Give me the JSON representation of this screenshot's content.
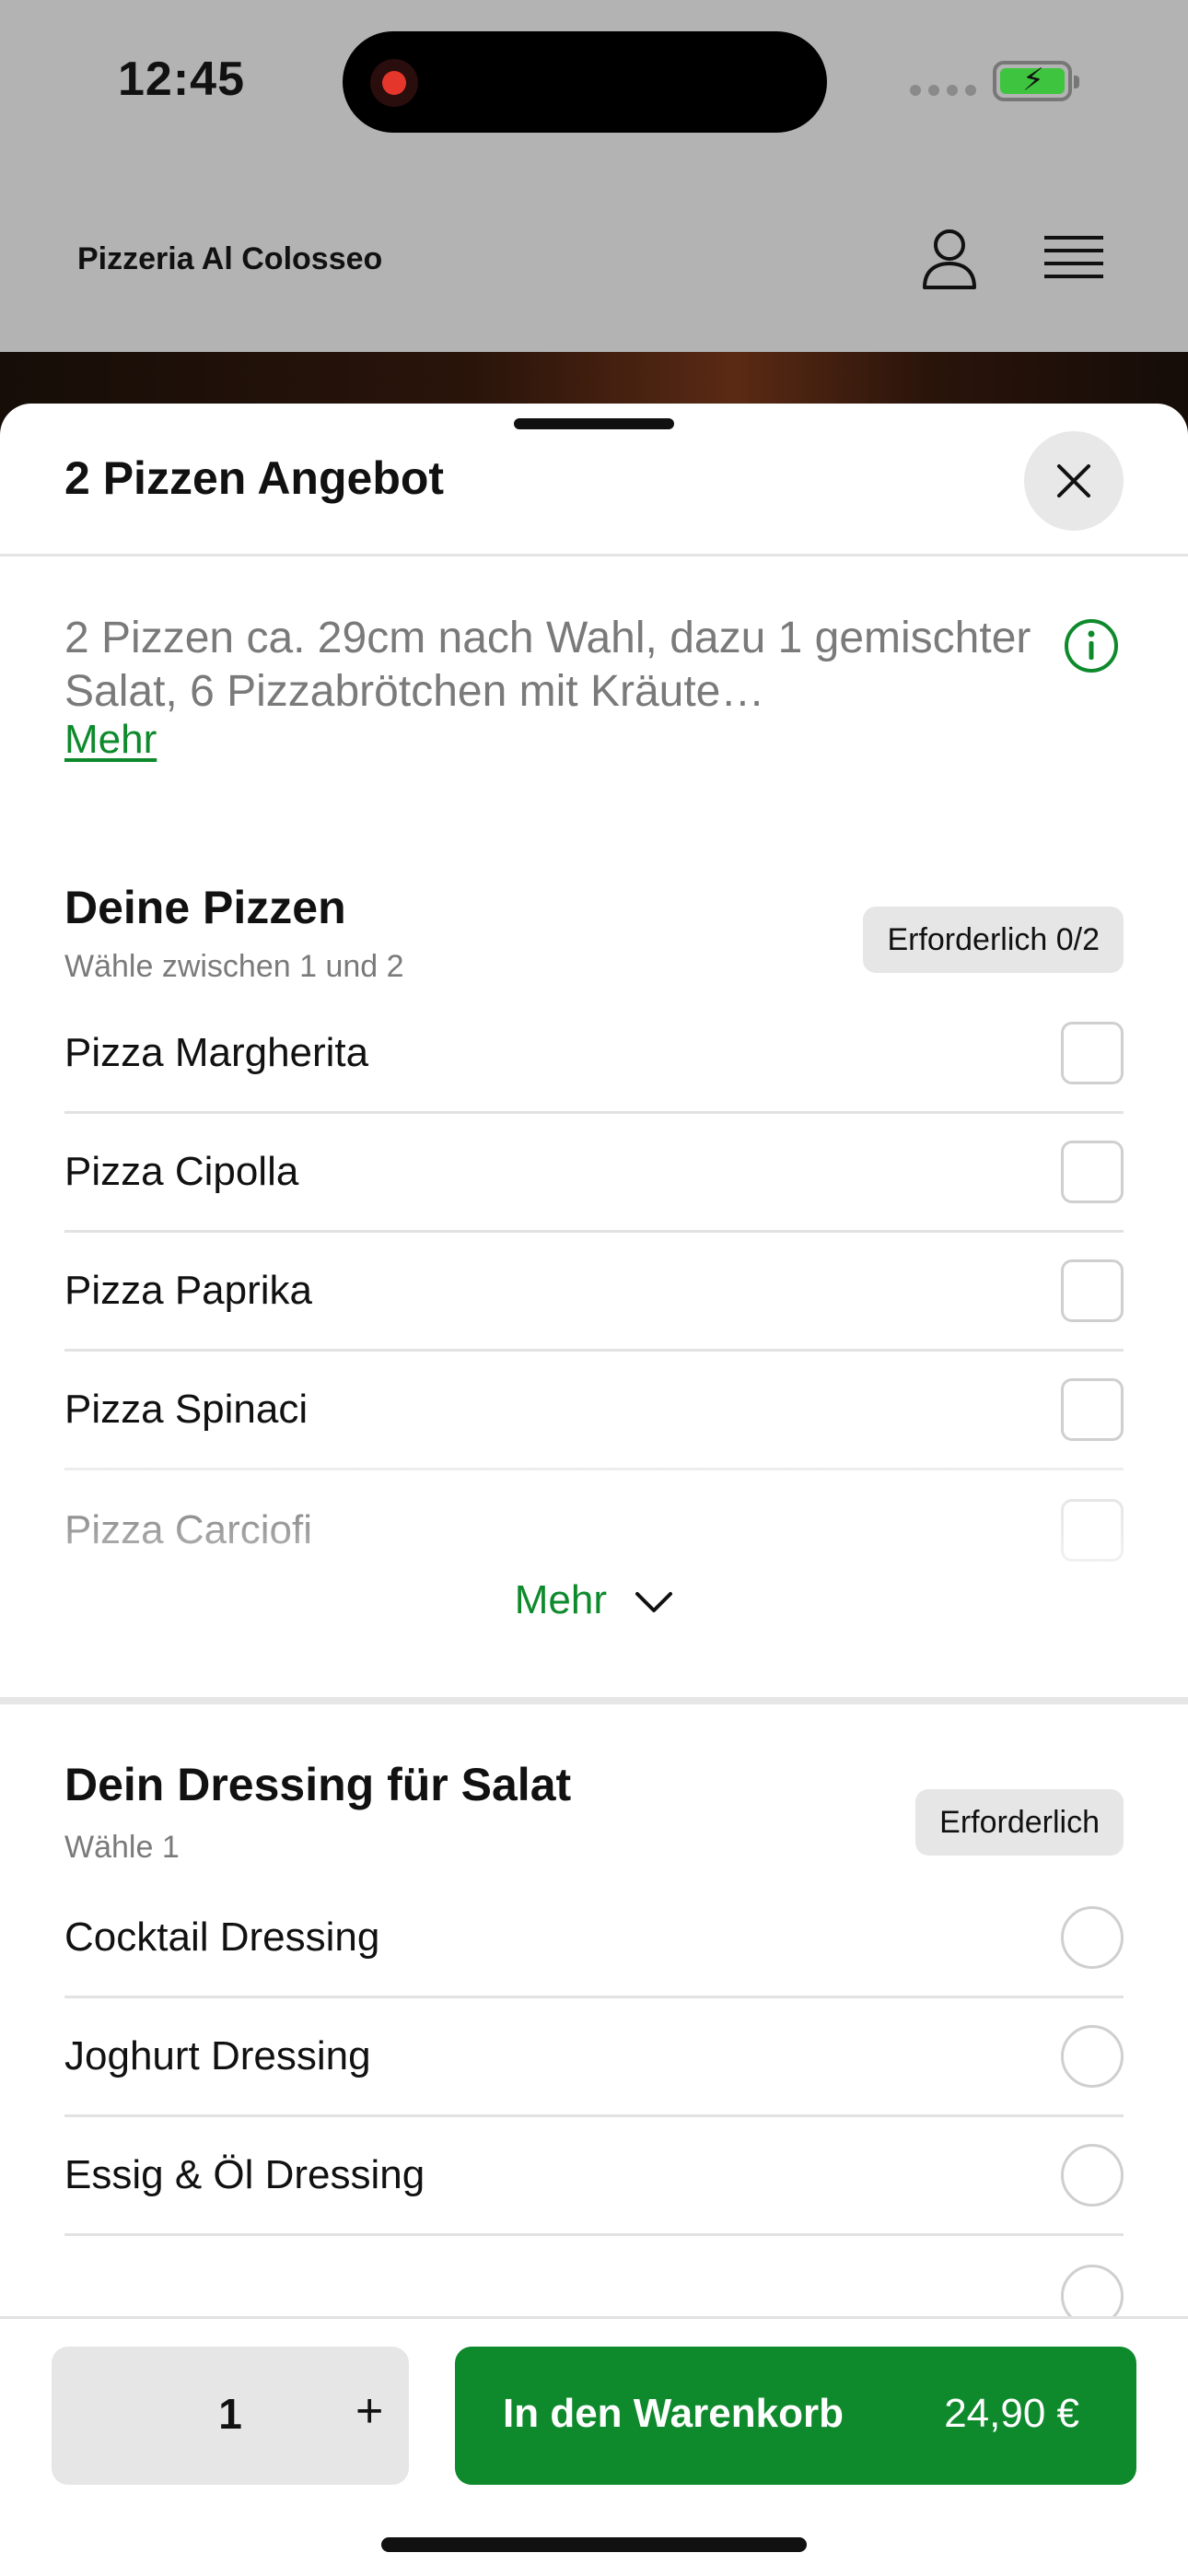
{
  "status_bar": {
    "time": "12:45"
  },
  "header": {
    "title": "Pizzeria Al Colosseo"
  },
  "sheet": {
    "title": "2 Pizzen Angebot",
    "description": "2 Pizzen ca. 29cm nach Wahl, dazu 1 gemischter Salat, 6 Pizzabrötchen mit Kräute…",
    "description_more": "Mehr"
  },
  "pizza_section": {
    "title": "Deine Pizzen",
    "subtitle": "Wähle zwischen 1 und 2",
    "badge": "Erforderlich 0/2",
    "options": [
      "Pizza Margherita",
      "Pizza Cipolla",
      "Pizza Paprika",
      "Pizza Spinaci",
      "Pizza Carciofi"
    ],
    "more_label": "Mehr"
  },
  "dressing_section": {
    "title": "Dein Dressing für Salat",
    "subtitle": "Wähle 1",
    "badge": "Erforderlich",
    "options": [
      "Cocktail Dressing",
      "Joghurt Dressing",
      "Essig & Öl Dressing"
    ]
  },
  "action_bar": {
    "quantity": "1",
    "plus_label": "+",
    "cart_label": "In den Warenkorb",
    "price": "24,90 €"
  },
  "colors": {
    "accent": "#0e8a2c",
    "overlay": "#b3b3b3",
    "badge_bg": "#e6e6e6"
  }
}
